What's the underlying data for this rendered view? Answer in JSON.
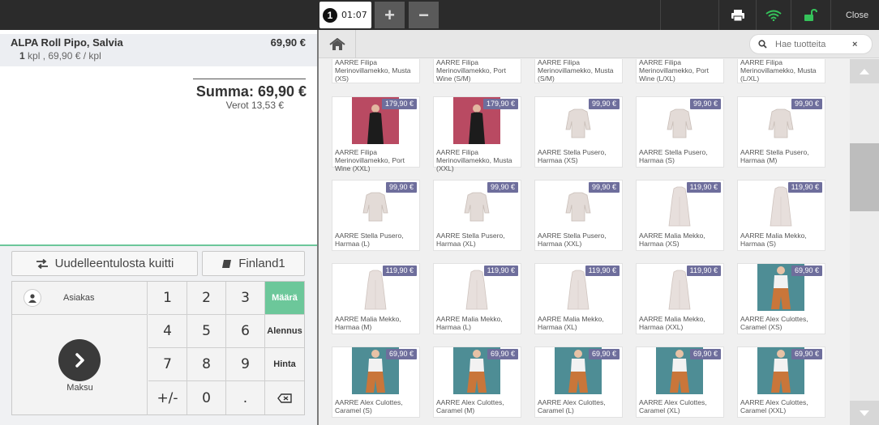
{
  "topbar": {
    "tab_number": "1",
    "tab_time": "01:07",
    "add_tab": "+",
    "remove_tab": "−",
    "close_label": "Close",
    "icons": [
      "printer-icon",
      "wifi-icon",
      "unlock-icon"
    ],
    "colors": {
      "wifi": "#35c25a",
      "lock": "#35c25a"
    }
  },
  "receipt": {
    "line": {
      "name": "ALPA Roll Pipo, Salvia",
      "price": "69,90 €",
      "qty": "1",
      "detail": "kpl , 69,90 € / kpl"
    },
    "total": "Summa: 69,90 €",
    "tax": "Verot 13,53 €"
  },
  "actions": {
    "reprint_label": "Uudelleentulosta kuitti",
    "register_label": "Finland1"
  },
  "keypad": {
    "customer": "Asiakas",
    "pay": "Maksu",
    "keys": [
      "1",
      "2",
      "3",
      "4",
      "5",
      "6",
      "7",
      "8",
      "9",
      "+/-",
      "0",
      "."
    ],
    "modes": [
      "Määrä",
      "Alennus",
      "Hinta"
    ],
    "active_mode": "Määrä"
  },
  "search": {
    "placeholder": "Hae tuotteita",
    "clear": "×"
  },
  "products_top": [
    "AARRE Filipa Merinovillamekko, Musta (XS)",
    "AARRE Filipa Merinovillamekko, Port Wine (S/M)",
    "AARRE Filipa Merinovillamekko, Musta (S/M)",
    "AARRE Filipa Merinovillamekko, Port Wine (L/XL)",
    "AARRE Filipa Merinovillamekko, Musta (L/XL)"
  ],
  "products": [
    {
      "name": "AARRE Filipa Merinovillamekko, Port Wine (XXL)",
      "price": "179,90 €",
      "img": "dress-black"
    },
    {
      "name": "AARRE Filipa Merinovillamekko, Musta (XXL)",
      "price": "179,90 €",
      "img": "dress-black"
    },
    {
      "name": "AARRE Stella Pusero, Harmaa (XS)",
      "price": "99,90 €",
      "img": "sweater"
    },
    {
      "name": "AARRE Stella Pusero, Harmaa (S)",
      "price": "99,90 €",
      "img": "sweater"
    },
    {
      "name": "AARRE Stella Pusero, Harmaa (M)",
      "price": "99,90 €",
      "img": "sweater"
    },
    {
      "name": "AARRE Stella Pusero, Harmaa (L)",
      "price": "99,90 €",
      "img": "sweater"
    },
    {
      "name": "AARRE Stella Pusero, Harmaa (XL)",
      "price": "99,90 €",
      "img": "sweater"
    },
    {
      "name": "AARRE Stella Pusero, Harmaa (XXL)",
      "price": "99,90 €",
      "img": "sweater"
    },
    {
      "name": "AARRE Malia Mekko, Harmaa (XS)",
      "price": "119,90 €",
      "img": "dress-grey"
    },
    {
      "name": "AARRE Malia Mekko, Harmaa (S)",
      "price": "119,90 €",
      "img": "dress-grey"
    },
    {
      "name": "AARRE Malia Mekko, Harmaa (M)",
      "price": "119,90 €",
      "img": "dress-grey"
    },
    {
      "name": "AARRE Malia Mekko, Harmaa (L)",
      "price": "119,90 €",
      "img": "dress-grey"
    },
    {
      "name": "AARRE Malia Mekko, Harmaa (XL)",
      "price": "119,90 €",
      "img": "dress-grey"
    },
    {
      "name": "AARRE Malia Mekko, Harmaa (XXL)",
      "price": "119,90 €",
      "img": "dress-grey"
    },
    {
      "name": "AARRE Alex Culottes, Caramel (XS)",
      "price": "69,90 €",
      "img": "culottes"
    },
    {
      "name": "AARRE Alex Culottes, Caramel (S)",
      "price": "69,90 €",
      "img": "culottes"
    },
    {
      "name": "AARRE Alex Culottes, Caramel (M)",
      "price": "69,90 €",
      "img": "culottes"
    },
    {
      "name": "AARRE Alex Culottes, Caramel (L)",
      "price": "69,90 €",
      "img": "culottes"
    },
    {
      "name": "AARRE Alex Culottes, Caramel (XL)",
      "price": "69,90 €",
      "img": "culottes"
    },
    {
      "name": "AARRE Alex Culottes, Caramel (XXL)",
      "price": "69,90 €",
      "img": "culottes"
    }
  ]
}
